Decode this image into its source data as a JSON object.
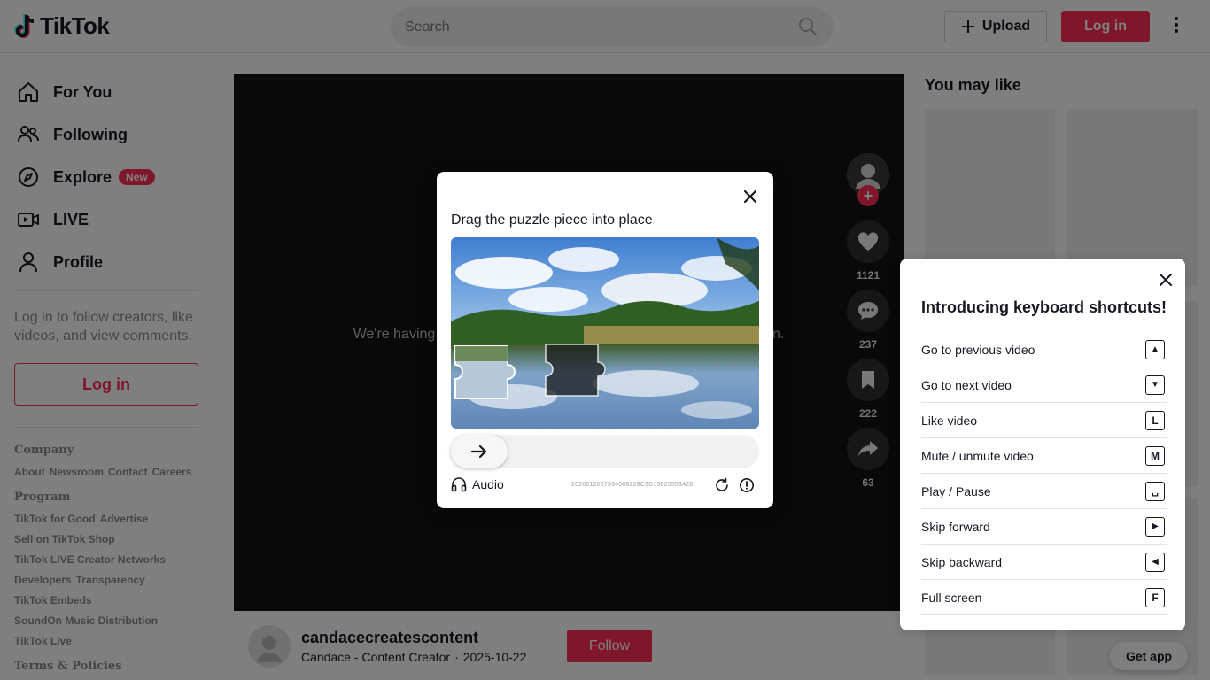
{
  "header": {
    "logo_text": "TikTok",
    "search_placeholder": "Search",
    "upload_label": "Upload",
    "login_label": "Log in"
  },
  "sidebar": {
    "items": [
      {
        "label": "For You",
        "icon": "home-icon"
      },
      {
        "label": "Following",
        "icon": "following-icon"
      },
      {
        "label": "Explore",
        "icon": "compass-icon",
        "badge": "New"
      },
      {
        "label": "LIVE",
        "icon": "live-icon"
      },
      {
        "label": "Profile",
        "icon": "profile-icon"
      }
    ],
    "login_hint": "Log in to follow creators, like videos, and view comments.",
    "login_button": "Log in",
    "footer": {
      "company_heading": "Company",
      "company_links": [
        "About",
        "Newsroom",
        "Contact",
        "Careers"
      ],
      "program_heading": "Program",
      "program_lines": [
        [
          "TikTok for Good",
          "Advertise"
        ],
        [
          "Sell on TikTok Shop"
        ],
        [
          "TikTok LIVE Creator Networks"
        ],
        [
          "Developers",
          "Transparency"
        ],
        [
          "TikTok Embeds"
        ],
        [
          "SoundOn Music Distribution"
        ],
        [
          "TikTok Live"
        ]
      ],
      "terms_heading": "Terms & Policies"
    }
  },
  "video": {
    "error_text": "We're having trouble playing this video. Please refresh and try again.",
    "counts": {
      "likes": "1121",
      "comments": "237",
      "saves": "222",
      "shares": "63"
    }
  },
  "author": {
    "username": "candacecreatescontent",
    "display_name": "Candace - Content Creator",
    "separator": "·",
    "date": "2025-10-22",
    "follow_label": "Follow"
  },
  "right": {
    "title": "You may like",
    "get_app": "Get app"
  },
  "shortcuts": {
    "title": "Introducing keyboard shortcuts!",
    "rows": [
      {
        "label": "Go to previous video",
        "key": "▲"
      },
      {
        "label": "Go to next video",
        "key": "▼"
      },
      {
        "label": "Like video",
        "key": "L"
      },
      {
        "label": "Mute / unmute video",
        "key": "M"
      },
      {
        "label": "Play / Pause",
        "key": "␣"
      },
      {
        "label": "Skip forward",
        "key": "▶"
      },
      {
        "label": "Skip backward",
        "key": "◀"
      },
      {
        "label": "Full screen",
        "key": "F"
      }
    ]
  },
  "captcha": {
    "title": "Drag the puzzle piece into place",
    "audio_label": "Audio",
    "code": "2026012007394068229C3D15825553428"
  },
  "colors": {
    "accent": "#fe2c55",
    "text": "#161823",
    "muted": "#8a8b91"
  }
}
